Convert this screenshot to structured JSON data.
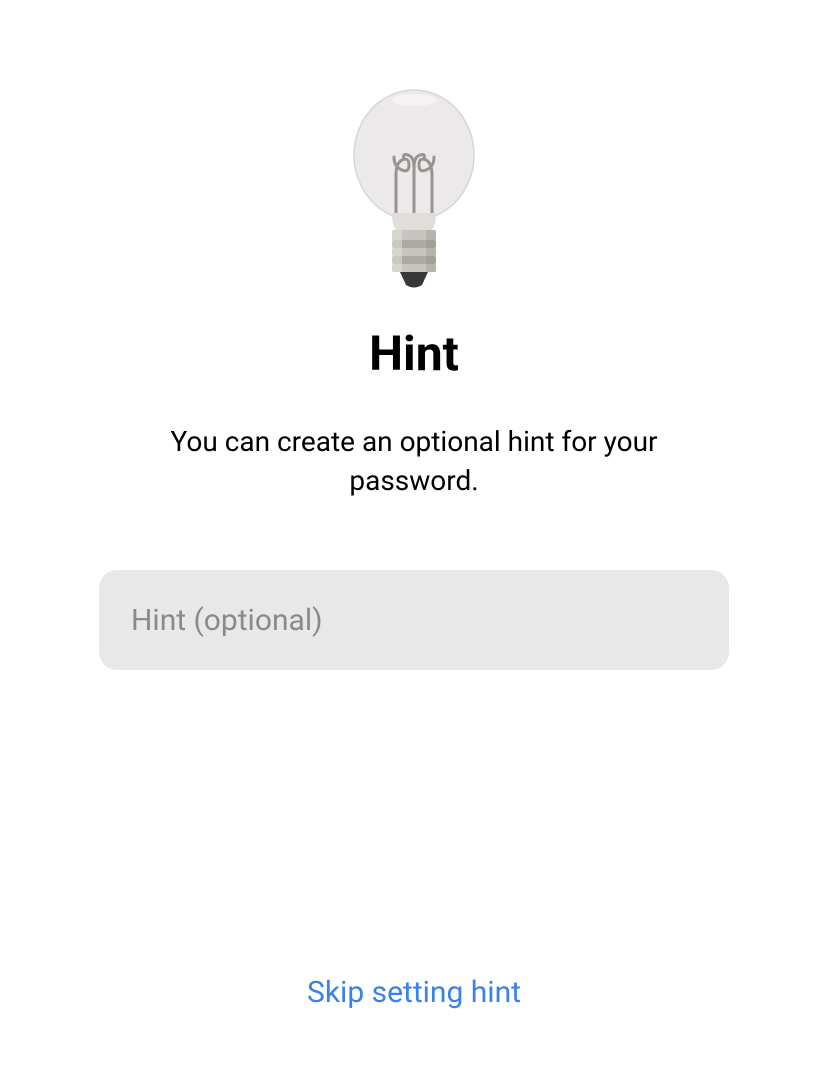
{
  "header": {
    "icon": "lightbulb-icon",
    "title": "Hint",
    "description": "You can create an optional hint for your password."
  },
  "form": {
    "hint_placeholder": "Hint (optional)",
    "hint_value": ""
  },
  "actions": {
    "skip_label": "Skip setting hint"
  }
}
